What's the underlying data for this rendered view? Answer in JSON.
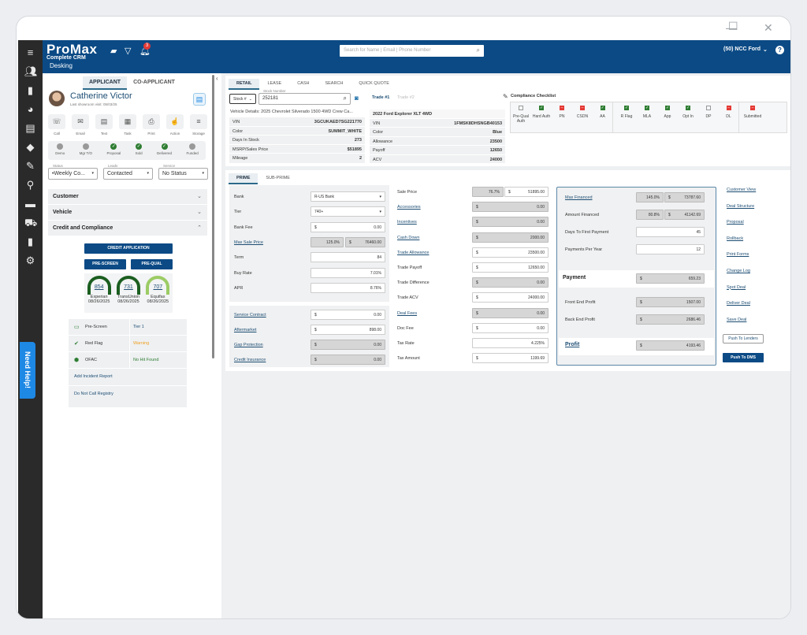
{
  "window": {
    "minimize": "—",
    "maximize": "☐",
    "close": "✕"
  },
  "header": {
    "logo": "ProMax",
    "logo_sub": "Complete CRM",
    "notifications": "3",
    "search_placeholder": "Search for Name | Email | Phone Number",
    "dealer": "(50) NCC Ford",
    "help": "?",
    "page": "Desking"
  },
  "sidebar": {
    "help_tab": "Need Help!",
    "icons": [
      "menu-icon",
      "users-icon",
      "bar-chart-icon",
      "pie-chart-icon",
      "document-icon",
      "handshake-icon",
      "wrench-icon",
      "user-search-icon",
      "car-icon",
      "car-trade-icon",
      "report-icon",
      "gear-icon"
    ]
  },
  "applicant": {
    "tabs": [
      "APPLICANT",
      "CO-APPLICANT"
    ],
    "name": "Catherine Victor",
    "last_visit": "Last showroom visit: 05/03/25",
    "actions": [
      {
        "label": "Call",
        "glyph": "☏"
      },
      {
        "label": "Email",
        "glyph": "✉"
      },
      {
        "label": "Text",
        "glyph": "▤"
      },
      {
        "label": "Task",
        "glyph": "▦"
      },
      {
        "label": "Print",
        "glyph": "⎙"
      },
      {
        "label": "Action",
        "glyph": "☝"
      },
      {
        "label": "Storage",
        "glyph": "≡"
      }
    ],
    "stages": [
      {
        "label": "Demo",
        "done": false
      },
      {
        "label": "Mgr T/O",
        "done": false
      },
      {
        "label": "Proposal",
        "done": true
      },
      {
        "label": "Sold",
        "done": true
      },
      {
        "label": "Delivered",
        "done": true
      },
      {
        "label": "Funded",
        "done": false
      }
    ],
    "selects": [
      {
        "label": "Status",
        "value": "•Weekly Co..."
      },
      {
        "label": "Leads",
        "value": "Contacted"
      },
      {
        "label": "Service",
        "value": "No Status"
      }
    ],
    "sections": [
      "Customer",
      "Vehicle",
      "Credit and Compliance"
    ],
    "credit_application": "CREDIT APPLICATION",
    "pre_screen": "PRE-SCREEN",
    "pre_qual": "PRE-QUAL",
    "scores": [
      {
        "value": "854",
        "bureau": "Experian",
        "date": "08/26/2025",
        "color": "#1b5e20"
      },
      {
        "value": "731",
        "bureau": "TransUnion",
        "date": "08/26/2025",
        "color": "#1b5e20"
      },
      {
        "value": "707",
        "bureau": "Equifax",
        "date": "08/26/2025",
        "color": "#9ccc65"
      }
    ],
    "checks": [
      {
        "label": "Pre-Screen",
        "value": "Tier 1",
        "color": "#1c4d73",
        "icon": "▭"
      },
      {
        "label": "Red Flag",
        "value": "Warning",
        "color": "#f0a020",
        "icon": "✔"
      },
      {
        "label": "OFAC",
        "value": "No Hit Found",
        "color": "#2e7d32",
        "icon": "⬢"
      }
    ],
    "add_incident": "Add Incident Report",
    "dnc": "Do Not Call Registry"
  },
  "deal_tabs": [
    "RETAIL",
    "LEASE",
    "CASH",
    "SEARCH",
    "QUICK QUOTE"
  ],
  "vehicle": {
    "stock_type": "Stock #",
    "stock_label": "Stock Number",
    "stock_value": "252181",
    "details_title": "Vehicle Details: 2025 Chevrolet Silverado 1500 4WD Crew Ca...",
    "rows": [
      [
        "VIN",
        "3GCUKAED7SG221770"
      ],
      [
        "Color",
        "SUMMIT_WHITE"
      ],
      [
        "Days In Stock",
        "273"
      ],
      [
        "MSRP/Sales Price",
        "$51895"
      ],
      [
        "Mileage",
        "2"
      ]
    ]
  },
  "trade": {
    "tabs": [
      "Trade #1",
      "Trade #2"
    ],
    "title": "2022 Ford Explorer XLT 4WD",
    "rows": [
      [
        "VIN",
        "1FMSK8DHSNGB40153"
      ],
      [
        "Color",
        "Blue"
      ],
      [
        "Allowance",
        "23500"
      ],
      [
        "Payoff",
        "12650"
      ],
      [
        "ACV",
        "24000"
      ]
    ]
  },
  "compliance": {
    "title": "Compliance Checklist",
    "items": [
      {
        "label": "Pre-Qual Auth",
        "state": "empty"
      },
      {
        "label": "Hard Auth",
        "state": "ok"
      },
      {
        "label": "PN",
        "state": "fail"
      },
      {
        "label": "CSDN",
        "state": "fail"
      },
      {
        "label": "AA",
        "state": "ok"
      },
      {
        "label": "R Flag",
        "state": "ok"
      },
      {
        "label": "MLA",
        "state": "ok"
      },
      {
        "label": "App",
        "state": "ok"
      },
      {
        "label": "Opt In",
        "state": "ok"
      },
      {
        "label": "DP",
        "state": "empty"
      },
      {
        "label": "DL",
        "state": "fail"
      },
      {
        "label": "Submitted",
        "state": "fail"
      }
    ]
  },
  "lender_tabs": [
    "PRIME",
    "SUB-PRIME"
  ],
  "lender": [
    {
      "label": "Bank",
      "value": "R-US Bank",
      "type": "select"
    },
    {
      "label": "Tier",
      "value": "740+",
      "type": "select"
    },
    {
      "label": "Bank Fee",
      "value": "0.00",
      "type": "money"
    },
    {
      "label": "Max Sale Price",
      "pct": "125.0%",
      "value": "76460.00",
      "type": "pctmoney",
      "link": true
    },
    {
      "label": "Term",
      "value": "84",
      "type": "num"
    },
    {
      "label": "Buy Rate",
      "value": "7.01%",
      "type": "num"
    },
    {
      "label": "APR",
      "value": "8.76%",
      "type": "num"
    }
  ],
  "products": [
    {
      "label": "Service Contract",
      "value": "0.00",
      "gray": false
    },
    {
      "label": "Aftermarket",
      "value": "898.00",
      "gray": false
    },
    {
      "label": "Gap Protection",
      "value": "0.00",
      "gray": true
    },
    {
      "label": "Credit Insurance",
      "value": "0.00",
      "gray": true
    }
  ],
  "pricing": [
    {
      "label": "Sale Price",
      "pct": "76.7%",
      "value": "51895.00"
    },
    {
      "label": "Accessories",
      "value": "0.00",
      "link": true,
      "gray": true
    },
    {
      "label": "Incentives",
      "value": "0.00",
      "link": true,
      "gray": true
    },
    {
      "label": "Cash Down",
      "value": "2000.00",
      "link": true,
      "gray": true
    },
    {
      "label": "Trade Allowance",
      "value": "23500.00",
      "link": true
    },
    {
      "label": "Trade Payoff",
      "value": "12650.00"
    },
    {
      "label": "Trade Difference",
      "value": "0.00",
      "gray": true
    },
    {
      "label": "Trade ACV",
      "value": "24000.00"
    },
    {
      "label": "Deal Fees",
      "value": "0.00",
      "link": true,
      "gray": true
    },
    {
      "label": "Doc Fee",
      "value": "0.00"
    },
    {
      "label": "Tax Rate",
      "value": "4.225%",
      "nodollar": true
    },
    {
      "label": "Tax Amount",
      "value": "1199.69"
    }
  ],
  "summary": {
    "max_financed": {
      "label": "Max Financed",
      "pct": "145.0%",
      "value": "73787.60"
    },
    "amount_financed": {
      "label": "Amount Financed",
      "pct": "80.8%",
      "value": "41142.69"
    },
    "days_first": {
      "label": "Days To First Payment",
      "value": "45"
    },
    "ppy": {
      "label": "Payments Per Year",
      "value": "12"
    },
    "payment": {
      "label": "Payment",
      "value": "659.23"
    },
    "front": {
      "label": "Front End Profit",
      "value": "1507.00"
    },
    "back": {
      "label": "Back End Profit",
      "value": "2686.46"
    },
    "profit": {
      "label": "Profit",
      "value": "4193.46"
    },
    "currency": "$"
  },
  "links": [
    "Customer View",
    "Deal Structure",
    "Proposal",
    "Rollback",
    "Print Forms",
    "Change Log",
    "Spot Deal",
    "Deliver Deal",
    "Save Deal"
  ],
  "push_lenders": "Push To Lenders",
  "push_dms": "Push To DMS"
}
